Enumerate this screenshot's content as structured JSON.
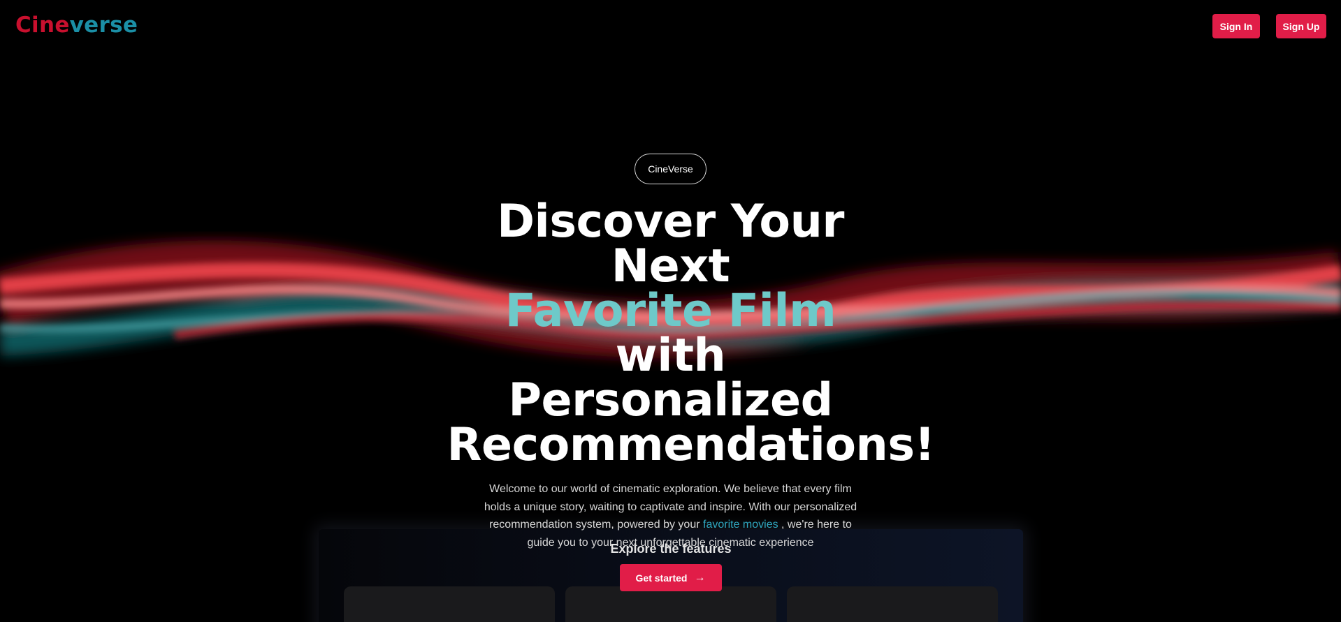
{
  "header": {
    "logo_part1": "Cine",
    "logo_part2": "verse",
    "signin_label": "Sign In",
    "signup_label": "Sign Up"
  },
  "hero": {
    "pill_label": "CineVerse",
    "headline_line1": "Discover Your Next",
    "headline_highlight": "Favorite Film",
    "headline_line2_rest": " with",
    "headline_line3": "Personalized",
    "headline_line4": "Recommendations!",
    "description_before_link": "Welcome to our world of cinematic exploration. We believe that every film holds a unique story, waiting to captivate and inspire. With our personalized recommendation system, powered by your ",
    "description_link": "favorite movies",
    "description_after_link": " , we're here to guide you to your next unforgettable cinematic experience",
    "cta_label": "Get started",
    "cta_icon": "arrow-right-icon"
  },
  "features": {
    "title": "Explore the features"
  },
  "colors": {
    "accent_red": "#e11d48",
    "logo_red": "#c8102e",
    "logo_teal": "#1b8fa6",
    "headline_teal": "#6ec9c9",
    "link_teal": "#2fa7c0"
  }
}
